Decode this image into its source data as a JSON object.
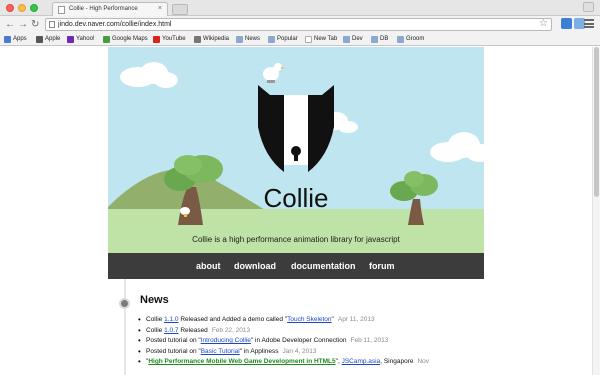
{
  "browser": {
    "tab_title": "Collie - High Performance",
    "tab_close": "×",
    "url": "jindo.dev.naver.com/collie/index.html",
    "back_glyph": "←",
    "forward_glyph": "→",
    "reload_glyph": "↻",
    "star_glyph": "☆",
    "bookmarks": [
      {
        "label": "Apps",
        "icon": "apps-icon",
        "color": "#4a7bd0"
      },
      {
        "label": "Apple",
        "icon": "apple-icon",
        "color": "#555555"
      },
      {
        "label": "Yahoo!",
        "icon": "yahoo-icon",
        "color": "#6b2bb5"
      },
      {
        "label": "Google Maps",
        "icon": "google-maps-icon",
        "color": "#4a9d3f"
      },
      {
        "label": "YouTube",
        "icon": "youtube-icon",
        "color": "#d8261c"
      },
      {
        "label": "Wikipedia",
        "icon": "wikipedia-icon",
        "color": "#777777"
      },
      {
        "label": "News",
        "icon": "folder-icon",
        "color": "#8ba8cf"
      },
      {
        "label": "Popular",
        "icon": "folder-icon",
        "color": "#8ba8cf"
      },
      {
        "label": "New Tab",
        "icon": "page-icon",
        "color": "#cccccc"
      },
      {
        "label": "Dev",
        "icon": "folder-icon",
        "color": "#8ba8cf"
      },
      {
        "label": "DB",
        "icon": "folder-icon",
        "color": "#8ba8cf"
      },
      {
        "label": "Groom",
        "icon": "folder-icon",
        "color": "#8ba8cf"
      }
    ]
  },
  "hero": {
    "logo_text": "Collie",
    "tagline": "Collie is a high performance animation library for javascript",
    "colors": {
      "sky": "#bfe6f0",
      "grass": "#bfe3a6",
      "hill": "#92b06c",
      "tree": "#6aa84f",
      "trunk": "#7a5a45"
    }
  },
  "nav": {
    "items": [
      "about",
      "download",
      "documentation",
      "forum"
    ]
  },
  "news": {
    "title": "News",
    "items": [
      {
        "pre": "Collie ",
        "link": "1.1.0",
        "mid": " Released and Added a demo called \"",
        "link2": "Touch Skeleton",
        "post": "\"",
        "date": "Apr 11, 2013"
      },
      {
        "pre": "Collie ",
        "link": "1.0.7",
        "mid": " Released",
        "link2": "",
        "post": "",
        "date": "Feb 22, 2013"
      },
      {
        "pre": "Posted tutorial on \"",
        "link": "Introducing Collie",
        "mid": "\" in Adobe Developer Connection",
        "link2": "",
        "post": "",
        "date": "Feb 11, 2013"
      },
      {
        "pre": "Posted tutorial on \"",
        "link": "Basic Tutorial",
        "mid": "\" in Appliness",
        "link2": "",
        "post": "",
        "date": "Jan 4, 2013"
      },
      {
        "pre": "\"",
        "link": "High Performance Mobile Web Game Development in HTML5",
        "mid": "\", ",
        "link2": "JSCamp.asia",
        "post": ", Singapore",
        "date": "Nov"
      }
    ]
  }
}
